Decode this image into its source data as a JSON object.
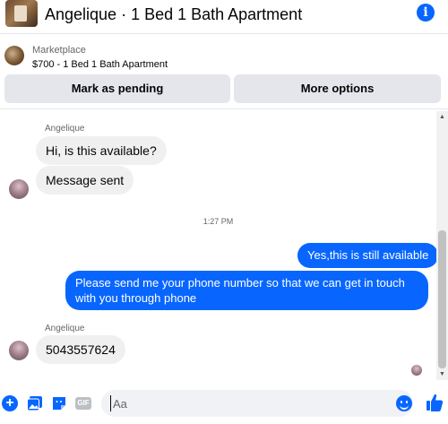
{
  "header": {
    "title": "Angelique · 1 Bed 1 Bath Apartment",
    "info_icon": "info-icon"
  },
  "marketplace": {
    "label": "Marketplace",
    "item": "$700 - 1 Bed 1 Bath Apartment",
    "pending_button": "Mark as pending",
    "more_button": "More options"
  },
  "thread": {
    "messages": [
      {
        "sender": "Angelique",
        "direction": "incoming",
        "text": "Hi, is this available?"
      },
      {
        "direction": "incoming",
        "text": "Message sent"
      },
      {
        "timestamp": "1:27 PM"
      },
      {
        "direction": "outgoing",
        "text": "Yes,this is still available"
      },
      {
        "direction": "outgoing",
        "text": "Please send me your phone  number so that we can get in touch with you through phone"
      },
      {
        "sender": "Angelique",
        "direction": "incoming",
        "text": "5043557624"
      }
    ]
  },
  "composer": {
    "placeholder": "Aa",
    "icons": [
      "plus-icon",
      "photo-icon",
      "sticker-icon",
      "gif-icon",
      "emoji-icon",
      "like-icon"
    ],
    "gif_label": "GIF"
  },
  "colors": {
    "accent": "#0866ff",
    "incoming_bubble": "#f0f0f0",
    "button_bg": "#e4e6eb"
  }
}
